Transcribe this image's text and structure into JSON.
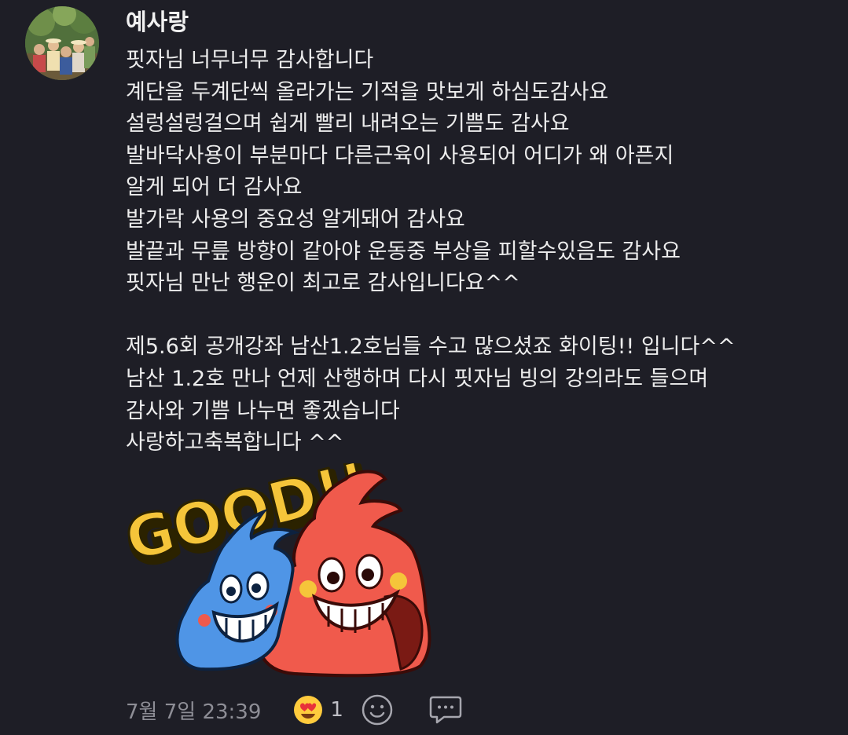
{
  "comment": {
    "author": "예사랑",
    "lines": [
      "핏자님 너무너무 감사합니다",
      "계단을 두계단씩 올라가는 기적을 맛보게 하심도감사요",
      "설렁설렁걸으며 쉽게 빨리 내려오는 기쁨도 감사요",
      "발바닥사용이 부분마다 다른근육이 사용되어 어디가 왜 아픈지",
      "알게 되어 더 감사요",
      "발가락 사용의 중요성 알게돼어 감사요",
      "발끝과 무릎 방향이 같아야 운동중 부상을 피할수있음도 감사요",
      "핏자님 만난 행운이 최고로 감사입니다요^^",
      "",
      "제5.6회 공개강좌 남산1.2호님들 수고 많으셨죠 화이팅!! 입니다^^",
      "남산 1.2호 만나 언제 산행하며 다시 핏자님 빙의 강의라도 들으며",
      "감사와 기쁨 나누면 좋겠습니다",
      "사랑하고축복합니다 ^^"
    ],
    "sticker": {
      "text": "GOOD!!",
      "icon": "good-sticker-two-monsters"
    },
    "timestamp": "7월 7일 23:39",
    "reaction": {
      "icon": "heart-eyes-emoji-icon",
      "count": "1"
    },
    "actions": {
      "add_reaction_icon": "smiley-add-reaction-icon",
      "reply_icon": "speech-bubble-reply-icon"
    }
  },
  "colors": {
    "background": "#1e1e26",
    "text": "#ececec",
    "muted": "#8e8e96",
    "sticker_blue": "#4f95e6",
    "sticker_red": "#f05a4c",
    "sticker_yellow": "#f5c53a"
  }
}
